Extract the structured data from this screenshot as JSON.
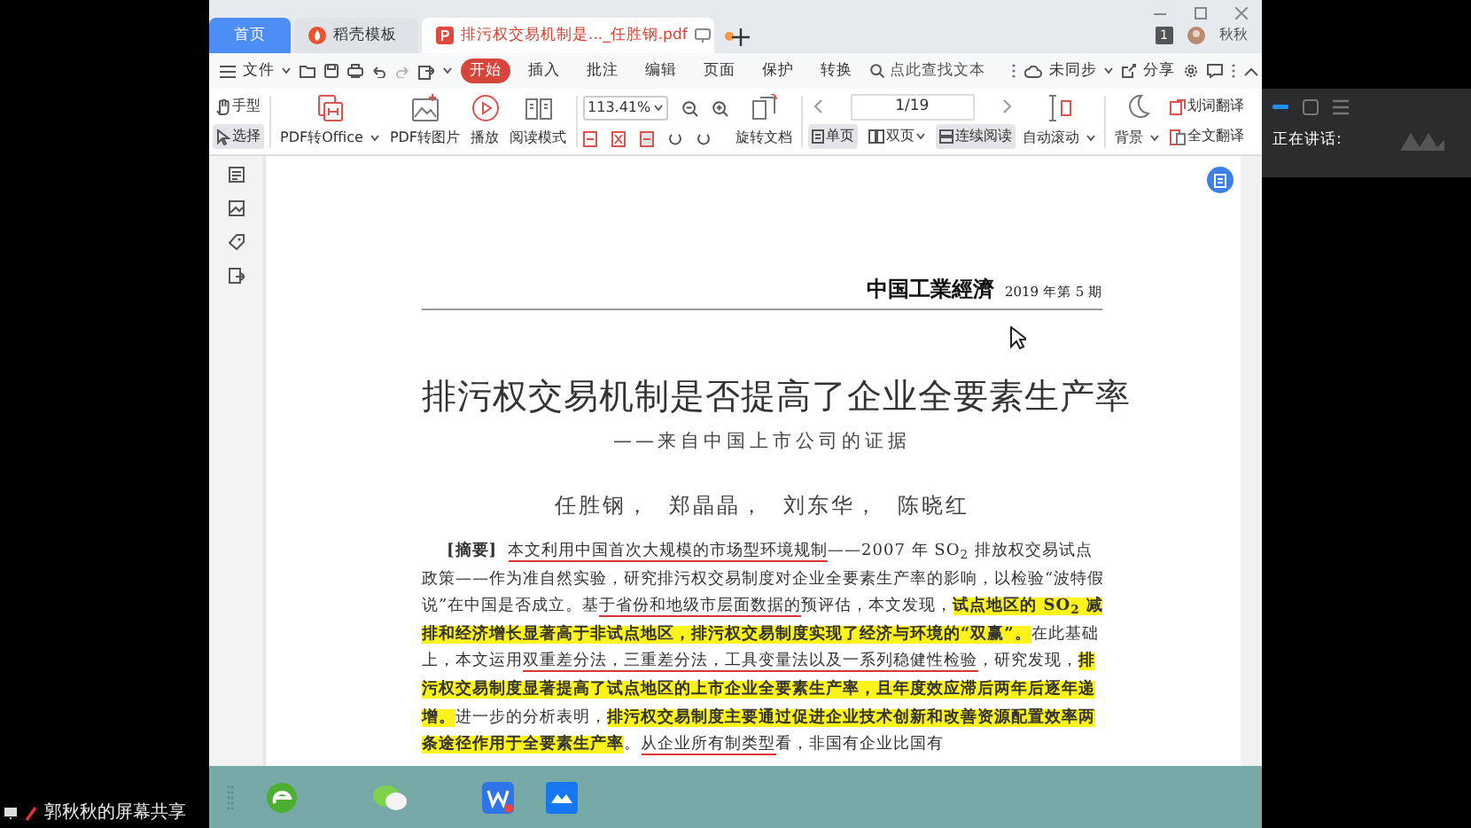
{
  "tabs": [
    {
      "label": "首页",
      "kind": "home",
      "selected": false
    },
    {
      "label": "稻壳模板",
      "kind": "template",
      "selected": false
    },
    {
      "label": "排污权交易机制是..._任胜钢.pdf",
      "kind": "pdf",
      "selected": true,
      "unsaved": true
    }
  ],
  "account": {
    "badge": "1",
    "user": "秋秋"
  },
  "menu": {
    "file": "文件",
    "tabs": [
      {
        "label": "开始",
        "selected": true
      },
      {
        "label": "插入",
        "selected": false
      },
      {
        "label": "批注",
        "selected": false
      },
      {
        "label": "编辑",
        "selected": false
      },
      {
        "label": "页面",
        "selected": false
      },
      {
        "label": "保护",
        "selected": false
      },
      {
        "label": "转换",
        "selected": false
      }
    ],
    "search_placeholder": "点此查找文本",
    "sync": "未同步",
    "share": "分享"
  },
  "toolbar": {
    "tools": [
      {
        "label": "手型",
        "kind": "hand",
        "selected": false
      },
      {
        "label": "选择",
        "kind": "select",
        "selected": true
      }
    ],
    "convert": [
      {
        "label": "PDF转Office",
        "kind": "pdf-office",
        "dropdown": true
      },
      {
        "label": "PDF转图片",
        "kind": "pdf-image",
        "dropdown": false
      },
      {
        "label": "播放",
        "kind": "play",
        "dropdown": false
      },
      {
        "label": "阅读模式",
        "kind": "read",
        "dropdown": false
      }
    ],
    "zoom": "113.41%",
    "rotate": "旋转文档",
    "page": "1/19",
    "views": [
      {
        "label": "单页",
        "kind": "single",
        "selected": true,
        "dropdown": false
      },
      {
        "label": "双页",
        "kind": "double",
        "selected": false,
        "dropdown": true
      },
      {
        "label": "连续阅读",
        "kind": "continuous",
        "selected": true,
        "dropdown": false
      }
    ],
    "auto_scroll": "自动滚动",
    "background": "背景",
    "translate": [
      {
        "label": "划词翻译",
        "kind": "word"
      },
      {
        "label": "全文翻译",
        "kind": "full"
      }
    ]
  },
  "document": {
    "journal": "中国工業經濟",
    "issue": "2019 年第 5 期",
    "title": "排污权交易机制是否提高了企业全要素生产率",
    "subtitle": "——来自中国上市公司的证据",
    "authors": "任胜钢，  郑晶晶，  刘东华，  陈晓红",
    "abstract_label": "[摘要]",
    "abstract": [
      {
        "text": "本文利用中国首次大规模的市场型环境规制",
        "highlighted": false,
        "underlined": true
      },
      {
        "text": "——2007 年 SO$_{2}$ 排放权交易试点政策——作为准自然实验，研究排污权交易制度对企业全要素生产率的影响，以检验“波特假说”在中国是否成立。基",
        "highlighted": false,
        "underlined": false
      },
      {
        "text": "于省份和地级市层面数据的",
        "highlighted": false,
        "underlined": true
      },
      {
        "text": "预评估，本文发现，",
        "highlighted": false,
        "underlined": false
      },
      {
        "text": "试点地区的 SO$_{2}$ 减排和经济增长显著高于非试点地区，排污权交易制度实现了经济与环境的“双赢”。",
        "highlighted": true,
        "underlined": false
      },
      {
        "text": "在此基础上，本文运用",
        "highlighted": false,
        "underlined": false
      },
      {
        "text": "双重差分法，三重差分法，工具变量法以及一系列稳健性检验",
        "highlighted": false,
        "underlined": true
      },
      {
        "text": "，研究发现，",
        "highlighted": false,
        "underlined": false
      },
      {
        "text": "排污权交易制度显著提高了试点地区的上市企业全要素生产率，且年度效应滞后两年后逐年递增。",
        "highlighted": true,
        "underlined": false
      },
      {
        "text": "进一步的分析表明，",
        "highlighted": false,
        "underlined": false
      },
      {
        "text": "排污权交易制度主要通过促进企业技术创新和改善资源配置效率两条途径作用于全要素生产率",
        "highlighted": true,
        "underlined": false
      },
      {
        "text": "。",
        "highlighted": false,
        "underlined": false
      },
      {
        "text": "从企业所有制类型",
        "highlighted": false,
        "underlined": true
      },
      {
        "text": "看，非国有企业比国有",
        "highlighted": false,
        "underlined": false
      }
    ]
  },
  "meeting": {
    "speaking_label": "正在讲话:"
  },
  "share_label": "郭秋秋的屏幕共享"
}
